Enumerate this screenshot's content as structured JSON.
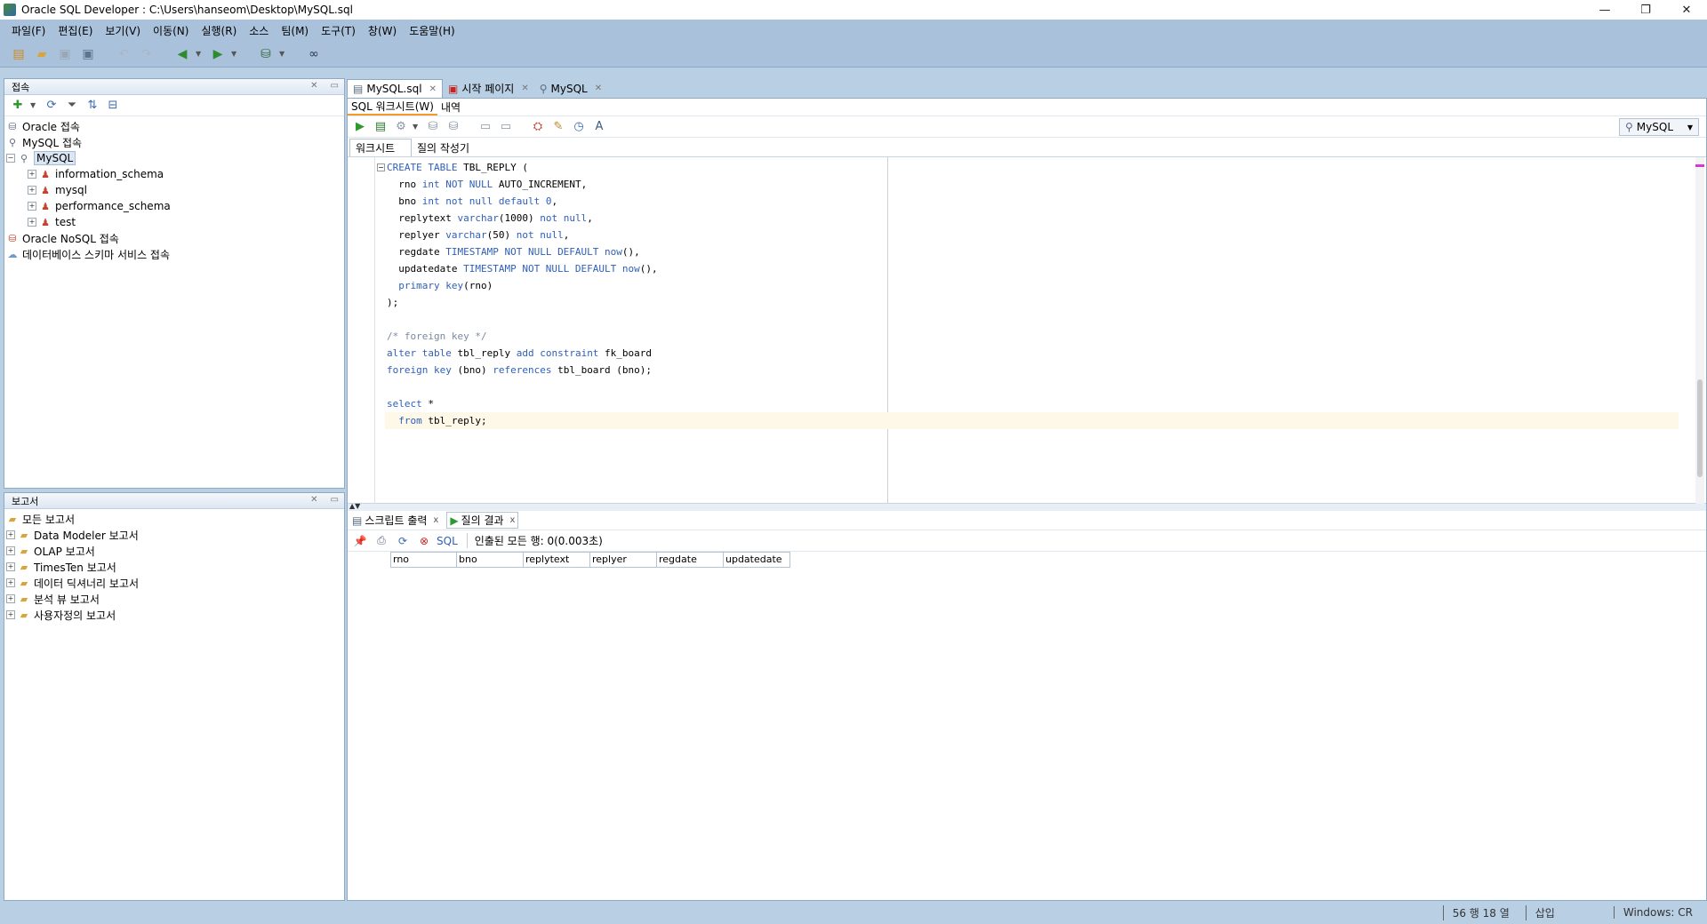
{
  "window": {
    "title": "Oracle SQL Developer : C:\\Users\\hanseom\\Desktop\\MySQL.sql",
    "controls": [
      "—",
      "❐",
      "✕"
    ]
  },
  "menu": [
    "파일(F)",
    "편집(E)",
    "보기(V)",
    "이동(N)",
    "실행(R)",
    "소스",
    "팀(M)",
    "도구(T)",
    "창(W)",
    "도움말(H)"
  ],
  "connections_panel": {
    "title": "접속",
    "tree": [
      {
        "label": "Oracle 접속",
        "level": 0,
        "icon": "database-icon"
      },
      {
        "label": "MySQL 접속",
        "level": 0,
        "icon": "connection-icon"
      },
      {
        "label": "MySQL",
        "level": 0,
        "icon": "mysql-connection-icon",
        "expanded": true,
        "selected": true
      },
      {
        "label": "information_schema",
        "level": 1,
        "icon": "schema-user-icon"
      },
      {
        "label": "mysql",
        "level": 1,
        "icon": "schema-user-icon"
      },
      {
        "label": "performance_schema",
        "level": 1,
        "icon": "schema-user-icon"
      },
      {
        "label": "test",
        "level": 1,
        "icon": "schema-user-icon"
      },
      {
        "label": "Oracle NoSQL 접속",
        "level": 0,
        "icon": "nosql-icon"
      },
      {
        "label": "데이터베이스 스키마 서비스 접속",
        "level": 0,
        "icon": "cloud-icon"
      }
    ]
  },
  "reports_panel": {
    "title": "보고서",
    "tree": [
      {
        "label": "모든 보고서",
        "level": 0
      },
      {
        "label": "Data Modeler 보고서",
        "level": 1
      },
      {
        "label": "OLAP 보고서",
        "level": 1
      },
      {
        "label": "TimesTen 보고서",
        "level": 1
      },
      {
        "label": "데이터 딕셔너리 보고서",
        "level": 1
      },
      {
        "label": "분석 뷰 보고서",
        "level": 1
      },
      {
        "label": "사용자정의 보고서",
        "level": 1
      }
    ]
  },
  "doc_tabs": [
    {
      "label": "MySQL.sql",
      "active": true
    },
    {
      "label": "시작 페이지",
      "active": false
    },
    {
      "label": "MySQL",
      "active": false
    }
  ],
  "editor": {
    "sub_tabs": [
      "SQL 워크시트(W)",
      "내역"
    ],
    "connection": "MySQL",
    "ws_tabs": [
      "워크시트",
      "질의 작성기"
    ],
    "code_lines": [
      [
        {
          "t": "CREATE TABLE",
          "k": "kw"
        },
        {
          "t": " TBL_REPLY (",
          "k": ""
        }
      ],
      [
        {
          "t": "  rno ",
          "k": ""
        },
        {
          "t": "int NOT NULL",
          "k": "kw"
        },
        {
          "t": " AUTO_INCREMENT,",
          "k": ""
        }
      ],
      [
        {
          "t": "  bno ",
          "k": ""
        },
        {
          "t": "int not null default",
          "k": "kw"
        },
        {
          "t": " ",
          "k": ""
        },
        {
          "t": "0",
          "k": "kw"
        },
        {
          "t": ",",
          "k": ""
        }
      ],
      [
        {
          "t": "  replytext ",
          "k": ""
        },
        {
          "t": "varchar",
          "k": "kw"
        },
        {
          "t": "(1000) ",
          "k": ""
        },
        {
          "t": "not null",
          "k": "kw"
        },
        {
          "t": ",",
          "k": ""
        }
      ],
      [
        {
          "t": "  replyer ",
          "k": ""
        },
        {
          "t": "varchar",
          "k": "kw"
        },
        {
          "t": "(50) ",
          "k": ""
        },
        {
          "t": "not null",
          "k": "kw"
        },
        {
          "t": ",",
          "k": ""
        }
      ],
      [
        {
          "t": "  regdate ",
          "k": ""
        },
        {
          "t": "TIMESTAMP NOT NULL DEFAULT now",
          "k": "kw"
        },
        {
          "t": "(),",
          "k": ""
        }
      ],
      [
        {
          "t": "  updatedate ",
          "k": ""
        },
        {
          "t": "TIMESTAMP NOT NULL DEFAULT now",
          "k": "kw"
        },
        {
          "t": "(),",
          "k": ""
        }
      ],
      [
        {
          "t": "  ",
          "k": ""
        },
        {
          "t": "primary key",
          "k": "kw"
        },
        {
          "t": "(rno)",
          "k": ""
        }
      ],
      [
        {
          "t": ");",
          "k": ""
        }
      ],
      [
        {
          "t": "",
          "k": ""
        }
      ],
      [
        {
          "t": "/* foreign key */",
          "k": "cm"
        }
      ],
      [
        {
          "t": "alter table",
          "k": "kw"
        },
        {
          "t": " tbl_reply ",
          "k": ""
        },
        {
          "t": "add constraint",
          "k": "kw"
        },
        {
          "t": " fk_board",
          "k": ""
        }
      ],
      [
        {
          "t": "foreign key",
          "k": "kw"
        },
        {
          "t": " (bno) ",
          "k": ""
        },
        {
          "t": "references",
          "k": "kw"
        },
        {
          "t": " tbl_board (bno);",
          "k": ""
        }
      ],
      [
        {
          "t": "",
          "k": ""
        }
      ],
      [
        {
          "t": "select",
          "k": "kw"
        },
        {
          "t": " *",
          "k": ""
        }
      ],
      [
        {
          "t": "  ",
          "k": ""
        },
        {
          "t": "from",
          "k": "kw"
        },
        {
          "t": " tbl_reply;",
          "k": ""
        }
      ]
    ],
    "current_line_index": 15
  },
  "results": {
    "tabs": [
      {
        "label": "스크립트 출력",
        "active": false
      },
      {
        "label": "질의 결과",
        "active": true
      }
    ],
    "sql_link": "SQL",
    "fetch_status": "인출된 모든 행: 0(0.003초)",
    "columns": [
      "rno",
      "bno",
      "replytext",
      "replyer",
      "regdate",
      "updatedate"
    ]
  },
  "status": {
    "position": "56 행 18 열",
    "mode": "삽입",
    "blank": "",
    "line_ending": "Windows: CR"
  }
}
